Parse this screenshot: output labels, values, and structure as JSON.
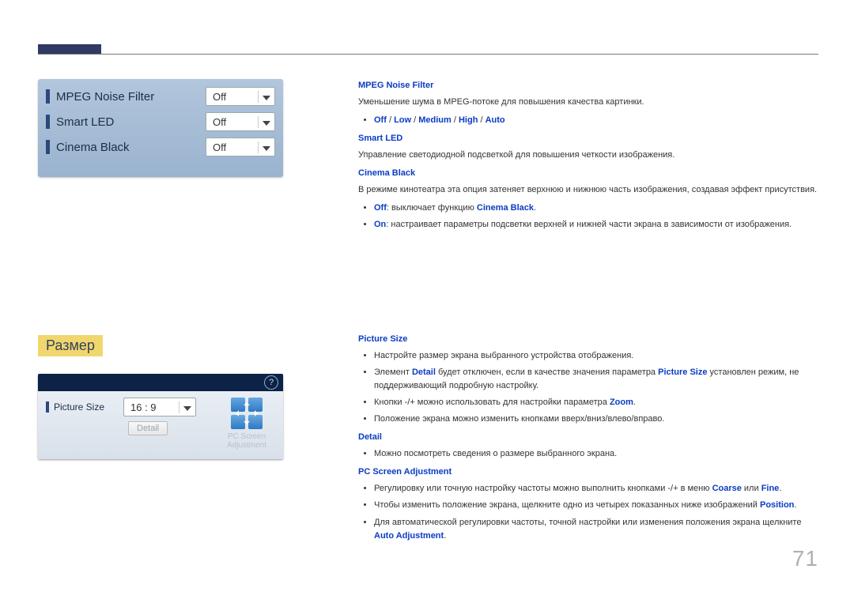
{
  "osd1": {
    "items": [
      {
        "label": "MPEG Noise Filter",
        "value": "Off"
      },
      {
        "label": "Smart LED",
        "value": "Off"
      },
      {
        "label": "Cinema Black",
        "value": "Off"
      }
    ]
  },
  "section2_title": "Размер",
  "osd2": {
    "help": "?",
    "picture_size_label": "Picture Size",
    "picture_size_value": "16 : 9",
    "detail_label": "Detail",
    "pc_adj_label_l1": "PC Screen",
    "pc_adj_label_l2": "Adjustment"
  },
  "block1": {
    "h_mpeg": "MPEG Noise Filter",
    "p_mpeg": "Уменьшение шума в MPEG-потоке для повышения качества картинки.",
    "opts": {
      "off": "Off",
      "low": "Low",
      "medium": "Medium",
      "high": "High",
      "auto": "Auto",
      "sep": " / "
    },
    "h_smart": "Smart LED",
    "p_smart": "Управление светодиодной подсветкой для повышения четкости изображения.",
    "h_cinema": "Cinema Black",
    "p_cinema": "В режиме кинотеатра эта опция затеняет верхнюю и нижнюю часть изображения, создавая эффект присутствия.",
    "li_off_1": "Off",
    "li_off_2": ": выключает функцию ",
    "li_off_3": "Cinema Black",
    "li_off_4": ".",
    "li_on_1": "On",
    "li_on_2": ": настраивает параметры подсветки верхней и нижней части экрана в зависимости от изображения."
  },
  "block2": {
    "h_ps": "Picture Size",
    "li1": "Настройте размер экрана выбранного устройства отображения.",
    "li2_a": "Элемент ",
    "li2_b": "Detail",
    "li2_c": " будет отключен, если в качестве значения параметра ",
    "li2_d": "Picture Size",
    "li2_e": " установлен режим, не поддерживающий подробную настройку.",
    "li3_a": "Кнопки -/+ можно использовать для настройки параметра ",
    "li3_b": "Zoom",
    "li3_c": ".",
    "li4": "Положение экрана можно изменить кнопками вверх/вниз/влево/вправо.",
    "h_detail": "Detail",
    "li_d1": "Можно посмотреть сведения о размере выбранного экрана.",
    "h_pc": "PC Screen Adjustment",
    "li_pc1_a": "Регулировку или точную настройку частоты можно выполнить кнопками -/+ в меню ",
    "li_pc1_b": "Coarse",
    "li_pc1_c": " или ",
    "li_pc1_d": "Fine",
    "li_pc1_e": ".",
    "li_pc2_a": "Чтобы изменить положение экрана, щелкните одно из четырех показанных ниже изображений ",
    "li_pc2_b": "Position",
    "li_pc2_c": ".",
    "li_pc3_a": "Для автоматической регулировки частоты, точной настройки или изменения положения экрана щелкните ",
    "li_pc3_b": "Auto Adjustment",
    "li_pc3_c": "."
  },
  "page_number": "71"
}
